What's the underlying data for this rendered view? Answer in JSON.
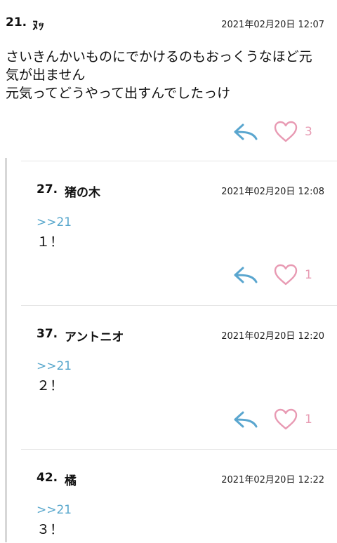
{
  "post": {
    "number": "21.",
    "name": "ﾇｯ",
    "date": "2021年02月20日 12:07",
    "lines": [
      "さいきんかいものにでかけるのもおっくうなほど元",
      "気が出ません",
      "元気ってどうやって出すんでしたっけ"
    ],
    "likes": "3"
  },
  "replies": [
    {
      "number": "27.",
      "name": "猪の木",
      "date": "2021年02月20日 12:08",
      "anchor": ">>21",
      "text": "１！",
      "likes": "1"
    },
    {
      "number": "37.",
      "name": "アントニオ",
      "date": "2021年02月20日 12:20",
      "anchor": ">>21",
      "text": "２！",
      "likes": "1"
    },
    {
      "number": "42.",
      "name": "橘",
      "date": "2021年02月20日 12:22",
      "anchor": ">>21",
      "text": "３！"
    }
  ],
  "colors": {
    "reply_icon": "#5aa6cf",
    "heart_icon": "#e89ab3",
    "anchor_link": "#58a7cc",
    "thread_bar": "#d7d7d7"
  },
  "icons": {
    "reply": "reply-arrow-icon",
    "like": "heart-outline-icon"
  }
}
